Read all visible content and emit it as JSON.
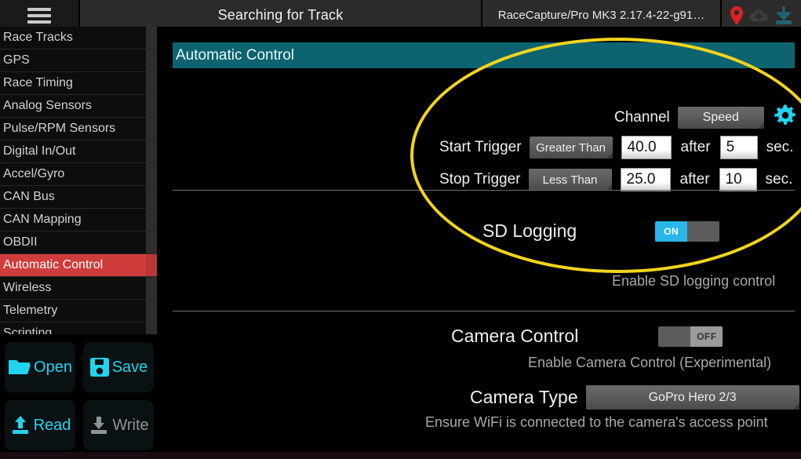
{
  "topbar": {
    "menu_icon": "hamburger-icon",
    "status_text": "Searching for Track",
    "device_text": "RaceCapture/Pro MK3 2.17.4-22-g91…",
    "icons": [
      {
        "name": "location-pin-icon",
        "color": "#e02020"
      },
      {
        "name": "cloud-upload-icon",
        "color": "#3a3a3a"
      },
      {
        "name": "download-icon",
        "color": "#1d6470"
      }
    ]
  },
  "sidebar": {
    "items": [
      {
        "label": "Race Tracks",
        "selected": false
      },
      {
        "label": "GPS",
        "selected": false
      },
      {
        "label": "Race Timing",
        "selected": false
      },
      {
        "label": "Analog Sensors",
        "selected": false
      },
      {
        "label": "Pulse/RPM Sensors",
        "selected": false
      },
      {
        "label": "Digital In/Out",
        "selected": false
      },
      {
        "label": "Accel/Gyro",
        "selected": false
      },
      {
        "label": "CAN Bus",
        "selected": false
      },
      {
        "label": "CAN Mapping",
        "selected": false
      },
      {
        "label": "OBDII",
        "selected": false
      },
      {
        "label": "Automatic Control",
        "selected": true
      },
      {
        "label": "Wireless",
        "selected": false
      },
      {
        "label": "Telemetry",
        "selected": false
      },
      {
        "label": "Scripting",
        "selected": false
      }
    ],
    "actions": [
      {
        "label": "Open",
        "icon": "folder-open-icon",
        "disabled": false
      },
      {
        "label": "Save",
        "icon": "floppy-disk-icon",
        "disabled": false
      },
      {
        "label": "Read",
        "icon": "upload-arrow-icon",
        "disabled": false
      },
      {
        "label": "Write",
        "icon": "download-arrow-icon",
        "disabled": true
      }
    ]
  },
  "main": {
    "panel_title": "Automatic Control",
    "channel": {
      "label": "Channel",
      "value": "Speed",
      "settings_icon": "gear-icon"
    },
    "start_trigger": {
      "label": "Start Trigger",
      "condition": "Greater Than",
      "threshold": "40.0",
      "after_label": "after",
      "delay": "5",
      "unit": "sec."
    },
    "stop_trigger": {
      "label": "Stop Trigger",
      "condition": "Less Than",
      "threshold": "25.0",
      "after_label": "after",
      "delay": "10",
      "unit": "sec."
    },
    "sd_logging": {
      "label": "SD Logging",
      "state": "ON",
      "hint": "Enable SD logging control"
    },
    "camera_control": {
      "label": "Camera Control",
      "state": "OFF",
      "hint": "Enable Camera Control (Experimental)"
    },
    "camera_type": {
      "label": "Camera Type",
      "value": "GoPro Hero 2/3",
      "hint": "Ensure WiFi is connected to the camera's access point"
    }
  },
  "annotation": {
    "highlight_shape": "ellipse",
    "highlight_color": "#f2d51b"
  },
  "colors": {
    "panel_header_teal": "#0d6470",
    "selection_red": "#cf3c3c",
    "accent_cyan": "#22d3ee",
    "toggle_on_blue": "#29b6e8"
  }
}
